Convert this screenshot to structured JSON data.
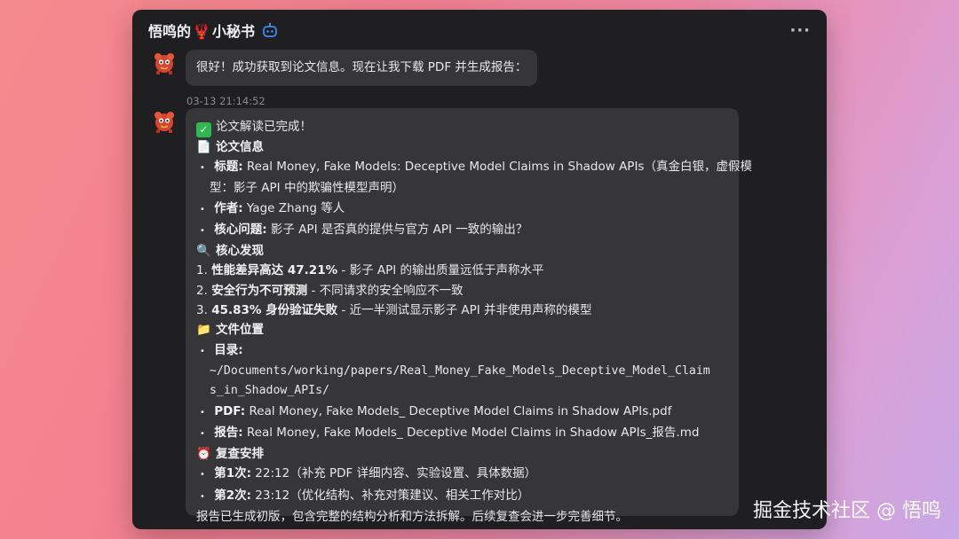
{
  "window": {
    "title_prefix": "悟鸣的",
    "title_emoji": "🦞",
    "title_suffix": "小秘书",
    "more_label": "···"
  },
  "messages": {
    "m1": {
      "text": "很好！成功获取到论文信息。现在让我下载 PDF 并生成报告："
    },
    "timestamp": "03-13 21:14:52",
    "m2": {
      "done": "论文解读已完成！",
      "info_heading": "论文信息",
      "title_label": "标题:",
      "title_value": "Real Money, Fake Models: Deceptive Model Claims in Shadow APIs（真金白银，虚假模",
      "title_value_cont": "型：影子 API 中的欺骗性模型声明）",
      "author_label": "作者:",
      "author_value": "Yage Zhang 等人",
      "question_label": "核心问题:",
      "question_value": "影子 API 是否真的提供与官方 API 一致的输出？",
      "findings_heading": "核心发现",
      "f1_num": "1.",
      "f1_bold": "性能差异高达 47.21%",
      "f1_text": " - 影子 API 的输出质量远低于声称水平",
      "f2_num": "2.",
      "f2_bold": "安全行为不可预测",
      "f2_text": " - 不同请求的安全响应不一致",
      "f3_num": "3.",
      "f3_bold": "45.83% 身份验证失败",
      "f3_text": " - 近一半测试显示影子 API 并非使用声称的模型",
      "files_heading": "文件位置",
      "dir_label": "目录:",
      "dir_path1": "~/Documents/working/papers/Real_Money_Fake_Models_Deceptive_Model_Claim",
      "dir_path2": "s_in_Shadow_APIs/",
      "pdf_label": "PDF:",
      "pdf_value": "Real Money, Fake Models_ Deceptive Model Claims in Shadow APIs.pdf",
      "report_label": "报告:",
      "report_value": "Real Money, Fake Models_ Deceptive Model Claims in Shadow APIs_报告.md",
      "review_heading": "复查安排",
      "r1_label": "第1次:",
      "r1_value": "22:12（补充 PDF 详细内容、实验设置、具体数据）",
      "r2_label": "第2次:",
      "r2_value": "23:12（优化结构、补充对策建议、相关工作对比）",
      "footer": "报告已生成初版，包含完整的结构分析和方法拆解。后续复查会进一步完善细节。"
    }
  },
  "watermark": "掘金技术社区 @ 悟鸣"
}
